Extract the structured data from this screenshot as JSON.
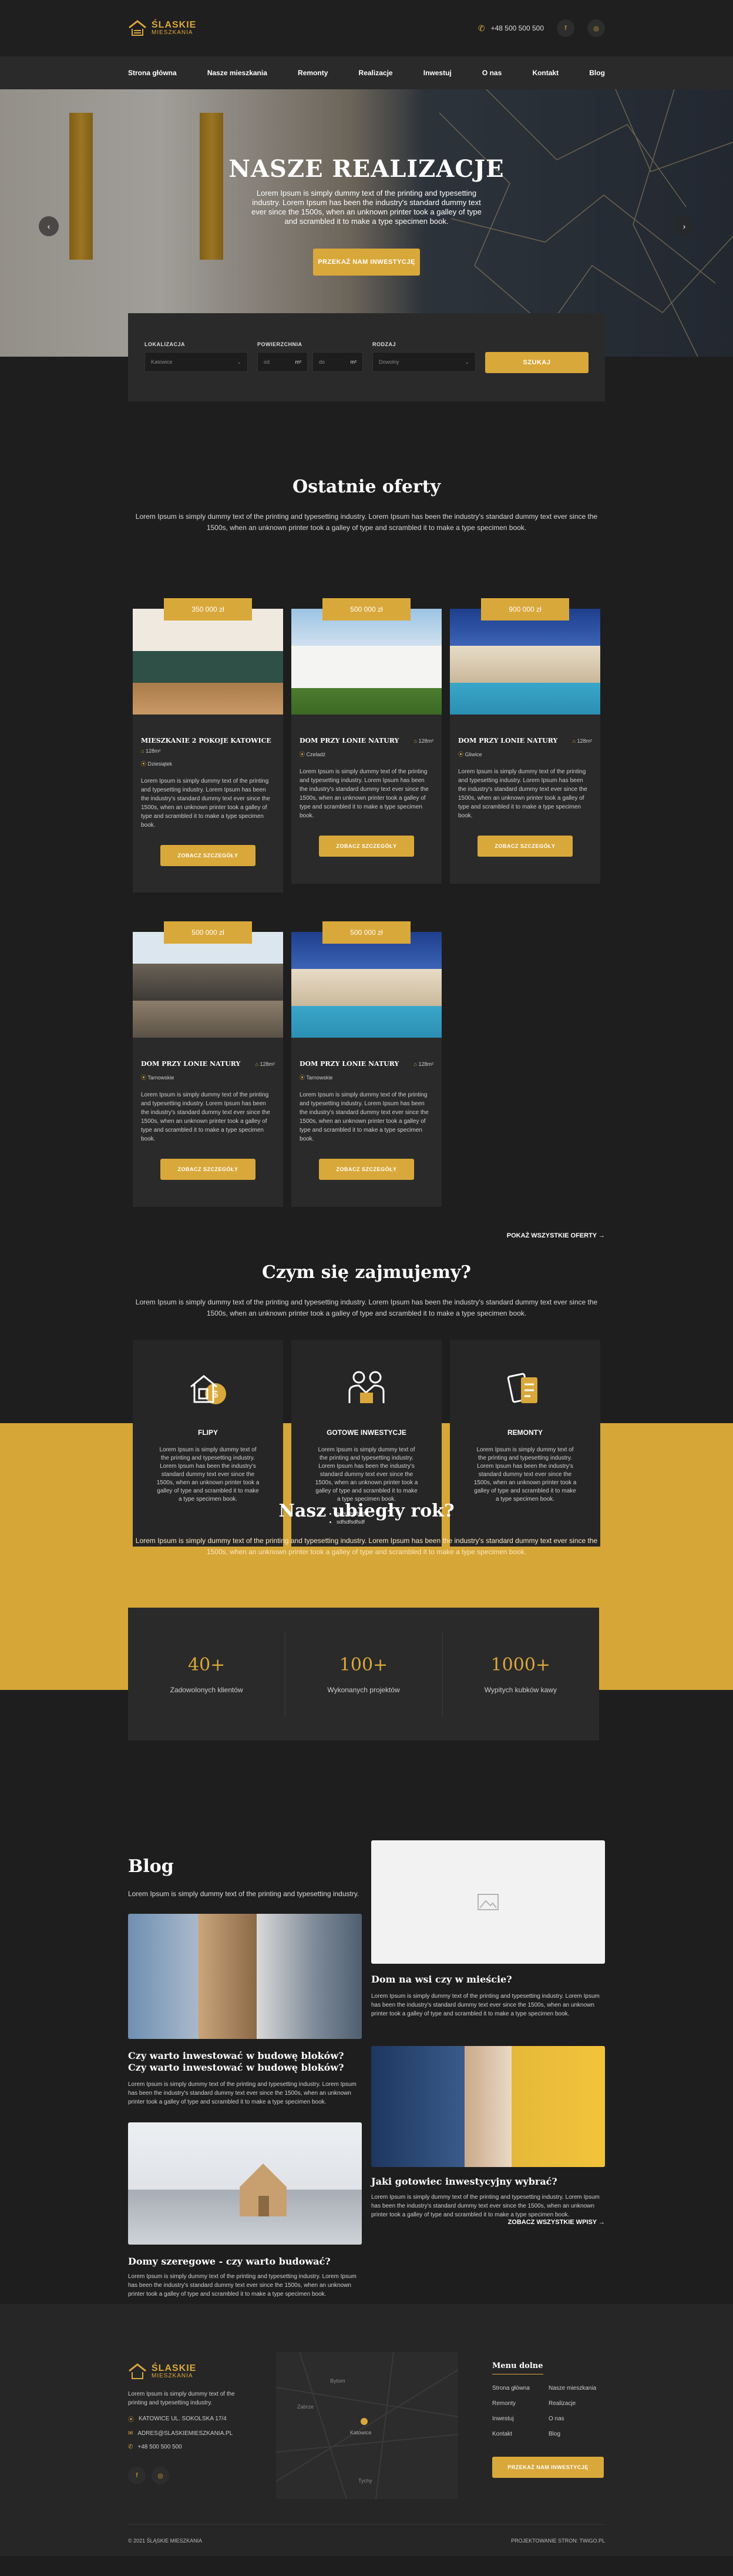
{
  "header": {
    "logo_line1": "ŚLASKIE",
    "logo_line2": "MIESZKANIA",
    "phone": "+48 500 500 500",
    "social": [
      "f",
      "◎"
    ]
  },
  "nav": [
    "Strona główna",
    "Nasze mieszkania",
    "Remonty",
    "Realizacje",
    "Inwestuj",
    "O nas",
    "Kontakt",
    "Blog"
  ],
  "hero": {
    "title": "NASZE REALIZACJE",
    "text": "Lorem Ipsum is simply dummy text of the printing and typesetting industry. Lorem Ipsum has been the industry's standard dummy text ever since the 1500s, when an unknown printer took a galley of type and scrambled it to make a type specimen book.",
    "button": "PRZEKAŻ NAM INWESTYCJĘ",
    "prev": "‹",
    "next": "›"
  },
  "search": {
    "location_label": "LOKALIZACJA",
    "location_value": "Katowice",
    "area_label": "POWIERZCHNIA",
    "area_from": "od",
    "area_to": "do",
    "area_unit": "m²",
    "rooms_label": "RODZAJ",
    "rooms_value": "Dowolny",
    "button": "SZUKAJ"
  },
  "offers": {
    "title": "Ostatnie oferty",
    "intro": "Lorem Ipsum is simply dummy text of the printing and typesetting industry. Lorem Ipsum has been the industry's standard dummy text ever since the 1500s, when an unknown printer took a galley of type and scrambled it to make a type specimen book.",
    "cards": [
      {
        "price": "350 000 zł",
        "title": "MIESZKANIE 2 POKOJE KATOWICE",
        "area": "128m²",
        "location": "Dziesiątek",
        "desc": "Lorem Ipsum is simply dummy text of the printing and typesetting industry. Lorem Ipsum has been the industry's standard dummy text ever since the 1500s, when an unknown printer took a galley of type and scrambled it to make a type specimen book.",
        "button": "ZOBACZ SZCZEGÓŁY"
      },
      {
        "price": "500 000 zł",
        "title": "DOM PRZY LONIE NATURY",
        "area": "128m²",
        "location": "Czeladź",
        "desc": "Lorem Ipsum is simply dummy text of the printing and typesetting industry. Lorem Ipsum has been the industry's standard dummy text ever since the 1500s, when an unknown printer took a galley of type and scrambled it to make a type specimen book.",
        "button": "ZOBACZ SZCZEGÓŁY"
      },
      {
        "price": "900 000 zł",
        "title": "DOM PRZY LONIE NATURY",
        "area": "128m²",
        "location": "Gliwice",
        "desc": "Lorem Ipsum is simply dummy text of the printing and typesetting industry. Lorem Ipsum has been the industry's standard dummy text ever since the 1500s, when an unknown printer took a galley of type and scrambled it to make a type specimen book.",
        "button": "ZOBACZ SZCZEGÓŁY"
      },
      {
        "price": "500 000 zł",
        "title": "DOM PRZY LONIE NATURY",
        "area": "128m²",
        "location": "Tarnowskie",
        "desc": "Lorem Ipsum is simply dummy text of the printing and typesetting industry. Lorem Ipsum has been the industry's standard dummy text ever since the 1500s, when an unknown printer took a galley of type and scrambled it to make a type specimen book.",
        "button": "ZOBACZ SZCZEGÓŁY"
      },
      {
        "price": "500 000 zł",
        "title": "DOM PRZY LONIE NATURY",
        "area": "128m²",
        "location": "Tarnowskie",
        "desc": "Lorem Ipsum is simply dummy text of the printing and typesetting industry. Lorem Ipsum has been the industry's standard dummy text ever since the 1500s, when an unknown printer took a galley of type and scrambled it to make a type specimen book.",
        "button": "ZOBACZ SZCZEGÓŁY"
      }
    ],
    "show_all": "POKAŻ WSZYSTKIE OFERTY →"
  },
  "services": {
    "title": "Czym się zajmujemy?",
    "intro": "Lorem Ipsum is simply dummy text of the printing and typesetting industry. Lorem Ipsum has been the industry's standard dummy text ever since the 1500s, when an unknown printer took a galley of type and scrambled it to make a type specimen book.",
    "cards": [
      {
        "title": "FLIPY",
        "icon": "house-money-icon",
        "text": "Lorem Ipsum is simply dummy text of the printing and typesetting industry. Lorem Ipsum has been the industry's standard dummy text ever since the 1500s, when an unknown printer took a galley of type and scrambled it to make a type specimen book."
      },
      {
        "title": "GOTOWE INWESTYCJE",
        "icon": "handshake-icon",
        "text": "Lorem Ipsum is simply dummy text of the printing and typesetting industry. Lorem Ipsum has been the industry's standard dummy text ever since the 1500s, when an unknown printer took a galley of type and scrambled it to make a type specimen book.",
        "list": [
          "adfsdfsdfsdfs",
          "sdfsdfsdfsdf"
        ]
      },
      {
        "title": "REMONTY",
        "icon": "renovation-icon",
        "text": "Lorem Ipsum is simply dummy text of the printing and typesetting industry. Lorem Ipsum has been the industry's standard dummy text ever since the 1500s, when an unknown printer took a galley of type and scrambled it to make a type specimen book."
      }
    ]
  },
  "year": {
    "title": "Nasz ubiegły rok?",
    "intro": "Lorem Ipsum is simply dummy text of the printing and typesetting industry. Lorem Ipsum has been the industry's standard dummy text ever since the 1500s, when an unknown printer took a galley of type and scrambled it to make a type specimen book.",
    "stats": [
      {
        "num": "40+",
        "label": "Zadowolonych klientów"
      },
      {
        "num": "100+",
        "label": "Wykonanych projektów"
      },
      {
        "num": "1000+",
        "label": "Wypitych kubków kawy"
      }
    ]
  },
  "blog": {
    "title": "Blog",
    "subtitle": "Lorem Ipsum is simply dummy text of the printing and typesetting industry.",
    "posts": [
      {
        "title": "Dom na wsi czy w mieście?",
        "text": "Lorem Ipsum is simply dummy text of the printing and typesetting industry. Lorem Ipsum has been the industry's standard dummy text ever since the 1500s, when an unknown printer took a galley of type and scrambled it to make a type specimen book."
      },
      {
        "title": "Czy warto inwestować w budowę bloków? Czy warto inwestować w budowę bloków?",
        "text": "Lorem Ipsum is simply dummy text of the printing and typesetting industry. Lorem Ipsum has been the industry's standard dummy text ever since the 1500s, when an unknown printer took a galley of type and scrambled it to make a type specimen book."
      },
      {
        "title": "Jaki gotowiec inwestycyjny wybrać?",
        "text": "Lorem Ipsum is simply dummy text of the printing and typesetting industry. Lorem Ipsum has been the industry's standard dummy text ever since the 1500s, when an unknown printer took a galley of type and scrambled it to make a type specimen book."
      },
      {
        "title": "Domy szeregowe - czy warto budować?",
        "text": "Lorem Ipsum is simply dummy text of the printing and typesetting industry. Lorem Ipsum has been the industry's standard dummy text ever since the 1500s, when an unknown printer took a galley of type and scrambled it to make a type specimen book."
      }
    ],
    "show_all": "ZOBACZ WSZYSTKIE WPISY →"
  },
  "footer": {
    "desc": "Lorem Ipsum is simply dummy text of the printing and typesetting industry.",
    "address": "KATOWICE UL. SOKOLSKA 17/4",
    "email": "ADRES@SLASKIEMIESZKANIA.PL",
    "phone": "+48 500 500 500",
    "map_labels": [
      "Bytom",
      "Zabrze",
      "Katowice",
      "Tychy"
    ],
    "menu_title": "Menu dolne",
    "menu": [
      "Strona główna",
      "Nasze mieszkania",
      "Remonty",
      "Realizacje",
      "Inwestuj",
      "O nas",
      "Kontakt",
      "Blog"
    ],
    "button": "PRZEKAŻ NAM INWESTYCJĘ",
    "copyright": "© 2021 ŚLĄSKIE MIESZKANIA",
    "credit": "PROJEKTOWANIE STRON: TWiGO.PL"
  },
  "colors": {
    "accent": "#d9a83a",
    "bg": "#1e1e1e",
    "card": "#2a2a2a"
  }
}
